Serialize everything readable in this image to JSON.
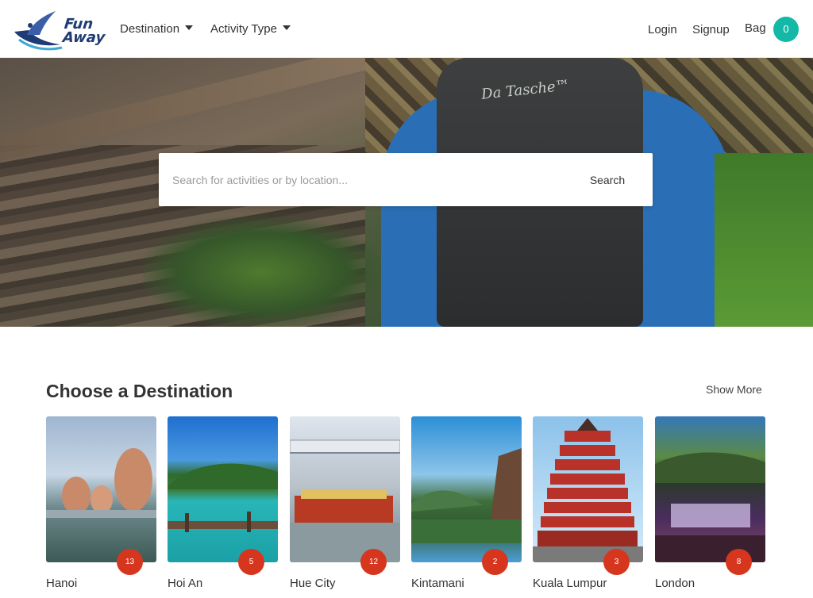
{
  "brand": {
    "line1": "Fun",
    "line2": "Away"
  },
  "nav": {
    "destination": "Destination",
    "activity_type": "Activity Type",
    "login": "Login",
    "signup": "Signup",
    "bag_label": "Bag",
    "bag_count": "0"
  },
  "hero": {
    "pack_text": "Da Tasche™",
    "search_placeholder": "Search for activities or by location...",
    "search_button": "Search"
  },
  "destinations": {
    "title": "Choose a Destination",
    "show_more": "Show More",
    "items": [
      {
        "name": "Hanoi",
        "count": "13"
      },
      {
        "name": "Hoi An",
        "count": "5"
      },
      {
        "name": "Hue City",
        "count": "12"
      },
      {
        "name": "Kintamani",
        "count": "2"
      },
      {
        "name": "Kuala Lumpur",
        "count": "3"
      },
      {
        "name": "London",
        "count": "8"
      }
    ]
  },
  "colors": {
    "accent_teal": "#14b8a6",
    "badge_red": "#d6361e",
    "logo_blue": "#1f3b73"
  }
}
